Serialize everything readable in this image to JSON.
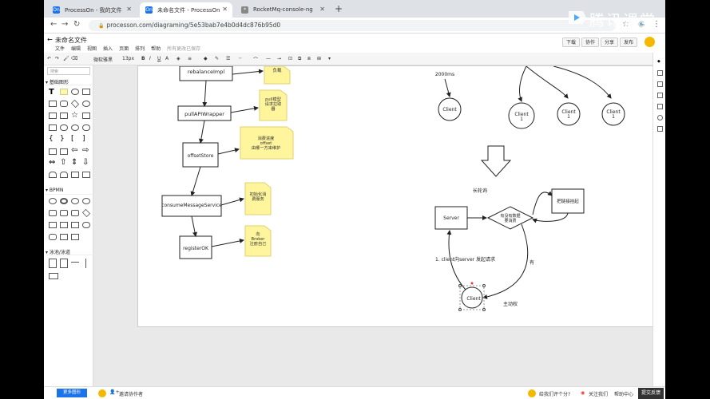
{
  "browser": {
    "tabs": [
      {
        "title": "ProcessOn - 我的文件",
        "favicon": "On"
      },
      {
        "title": "未命名文件 - ProcessOn",
        "favicon": "On"
      },
      {
        "title": "RocketMq-console-ng",
        "favicon": "*"
      }
    ],
    "url": "processon.com/diagraming/5e53bab7e4b0d4dc876b95d0"
  },
  "app": {
    "doc_title": "未命名文件",
    "menus": [
      "文件",
      "编辑",
      "视图",
      "插入",
      "页面",
      "排列",
      "帮助",
      "所有更改已保存"
    ],
    "actions": [
      "下载",
      "协作",
      "分享",
      "发布"
    ]
  },
  "toolbar": {
    "font": "微软雅黑",
    "size": "13px"
  },
  "sidebar": {
    "search_placeholder": "搜索",
    "sections": [
      "基础图形",
      "BPMN",
      "泳池/泳道"
    ],
    "more_button": "更多图形"
  },
  "diagram": {
    "left_flow": {
      "boxes": [
        "rebalanceImpl",
        "pullAPIWrapper",
        "offsetStore",
        "consumeMessageService",
        "registerOK"
      ],
      "notes": [
        "负载",
        "pull模型请求拉取器",
        "消费进度offset由哪一方来维护",
        "初始化消费服务",
        "向Broker注册自己"
      ]
    },
    "top_right": {
      "interval_label": "2000ms",
      "clients": [
        "Client",
        "Client 1",
        "Client 1",
        "Client 1"
      ]
    },
    "long_poll": {
      "title": "长轮询",
      "server": "Server",
      "decision": "有没有数据要消费",
      "hold": "把链接挂起",
      "yes_label": "有",
      "request_label": "1. client向server 发起请求",
      "client": "Client",
      "active_label": "主动权"
    }
  },
  "bottombar": {
    "invite": "邀请协作者",
    "feedback": "给我们评个分?",
    "follow": "关注我们",
    "help": "帮助中心",
    "submit": "提交反馈"
  },
  "watermark": "腾讯课堂"
}
